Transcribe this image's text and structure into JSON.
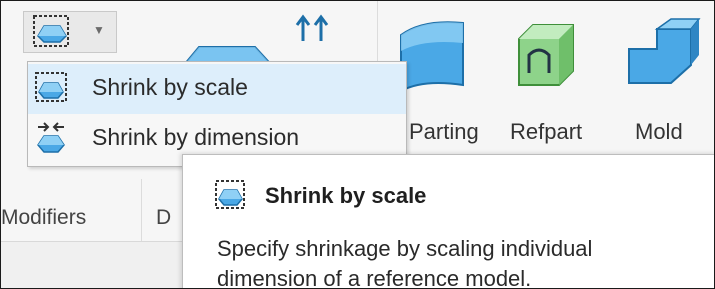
{
  "ribbon": {
    "buttons": {
      "parting": "Parting",
      "refpart": "Refpart",
      "mold": "Mold"
    },
    "groups": {
      "modifiers": "Modifiers",
      "partial": "D"
    }
  },
  "dropdown": {
    "items": [
      {
        "label": "Shrink by scale",
        "icon": "shrink-by-scale-icon",
        "active": true
      },
      {
        "label": "Shrink by dimension",
        "icon": "shrink-by-dimension-icon",
        "active": false
      }
    ]
  },
  "tooltip": {
    "title": "Shrink by scale",
    "description_line1": "Specify shrinkage by scaling individual",
    "description_line2": "dimension of a reference model.",
    "icon": "shrink-by-scale-icon"
  },
  "colors": {
    "hover_bg": "#ddeefb",
    "icon_blue": "#4aa8e6",
    "icon_green": "#8ed38a",
    "ribbon_bg": "#f6f6f6"
  }
}
